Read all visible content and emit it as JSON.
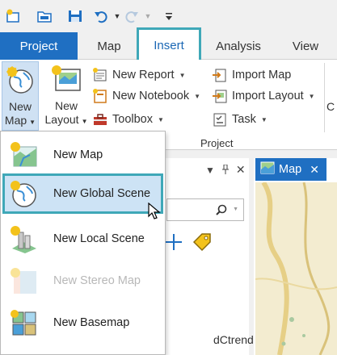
{
  "quick_access": {
    "icons": [
      "new-project-icon",
      "open-project-icon",
      "save-icon",
      "undo-icon",
      "redo-icon",
      "customize-icon"
    ]
  },
  "ribbon_tabs": {
    "project": "Project",
    "map": "Map",
    "insert": "Insert",
    "analysis": "Analysis",
    "view": "View"
  },
  "ribbon": {
    "new_map": {
      "line1": "New",
      "line2": "Map"
    },
    "new_layout": {
      "line1": "New",
      "line2": "Layout"
    },
    "new_report": "New Report",
    "new_notebook": "New Notebook",
    "toolbox": "Toolbox",
    "import_map": "Import Map",
    "import_layout": "Import Layout",
    "task": "Task",
    "group_label": "Project",
    "cut_label": "C"
  },
  "new_map_menu": {
    "items": [
      {
        "label": "New Map",
        "icon": "map-icon",
        "state": "normal"
      },
      {
        "label": "New Global Scene",
        "icon": "globe-icon",
        "state": "selected"
      },
      {
        "label": "New Local Scene",
        "icon": "local-scene-icon",
        "state": "normal"
      },
      {
        "label": "New Stereo Map",
        "icon": "stereo-map-icon",
        "state": "disabled"
      },
      {
        "label": "New Basemap",
        "icon": "basemap-icon",
        "state": "normal"
      }
    ]
  },
  "background_pane": {
    "fragment_text": "dCtrends"
  },
  "map_view": {
    "tab_label": "Map"
  },
  "colors": {
    "accent_blue": "#1f6fc2",
    "highlight_teal": "#3fa8b8",
    "selection_fill": "#cde3f5"
  }
}
